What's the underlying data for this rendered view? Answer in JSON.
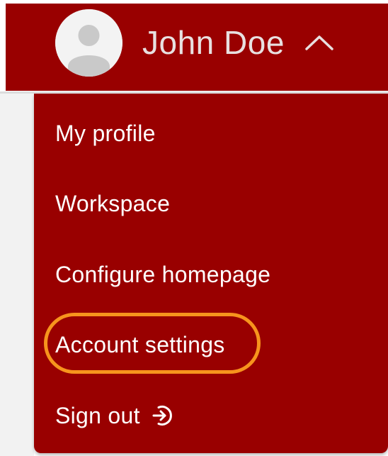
{
  "header": {
    "user_name": "John Doe",
    "avatar_icon": "user-avatar-icon",
    "toggle_icon": "chevron-up-icon"
  },
  "menu": {
    "items": [
      {
        "label": "My profile"
      },
      {
        "label": "Workspace"
      },
      {
        "label": "Configure homepage"
      },
      {
        "label": "Account settings"
      },
      {
        "label": "Sign out",
        "icon": "sign-out-icon"
      }
    ]
  },
  "colors": {
    "brand": "#990000",
    "highlight": "#f7941d",
    "text": "#ffffff"
  }
}
